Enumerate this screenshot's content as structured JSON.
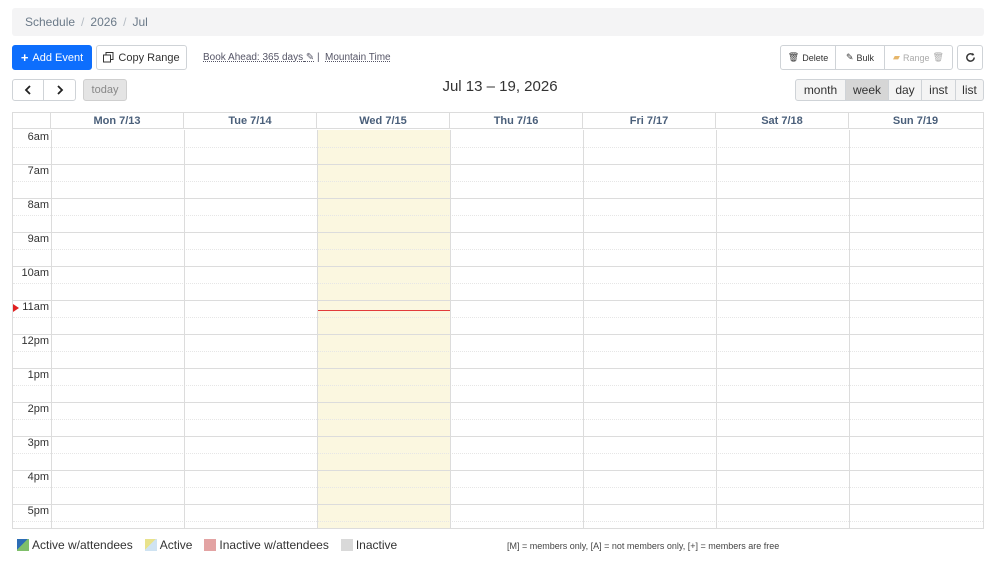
{
  "breadcrumb": [
    "Schedule",
    "2026",
    "Jul"
  ],
  "toolbar": {
    "add_event": "Add Event",
    "copy_range": "Copy Range",
    "book_ahead": "Book Ahead: 365 days",
    "separator": "|",
    "timezone": "Mountain Time",
    "delete": "Delete",
    "bulk": "Bulk",
    "range": "Range"
  },
  "nav": {
    "today": "today"
  },
  "title": "Jul 13 – 19, 2026",
  "views": [
    "month",
    "week",
    "day",
    "inst",
    "list"
  ],
  "active_view": "week",
  "days": [
    "Mon 7/13",
    "Tue 7/14",
    "Wed 7/15",
    "Thu 7/16",
    "Fri 7/17",
    "Sat 7/18",
    "Sun 7/19"
  ],
  "today_index": 2,
  "hours": [
    "6am",
    "7am",
    "8am",
    "9am",
    "10am",
    "11am",
    "12pm",
    "1pm",
    "2pm",
    "3pm",
    "4pm",
    "5pm"
  ],
  "now_hour_offset": 5.3,
  "legend": [
    {
      "label": "Active w/attendees",
      "color": "#7fbf6a",
      "accent": "#2d6db5"
    },
    {
      "label": "Active",
      "color": "#cfe3f2",
      "accent": "#e8e28c"
    },
    {
      "label": "Inactive w/attendees",
      "color": "#e3a3a3",
      "accent": "#e3a3a3"
    },
    {
      "label": "Inactive",
      "color": "#d9d9d9",
      "accent": "#d9d9d9"
    }
  ],
  "footnote": "[M] = members only, [A] = not members only, [+] = members are free",
  "colors": {
    "primary": "#0d6efd",
    "today_bg": "#fbf7e0",
    "now_line": "#e23b3b",
    "day_header": "#4a5f7a"
  }
}
